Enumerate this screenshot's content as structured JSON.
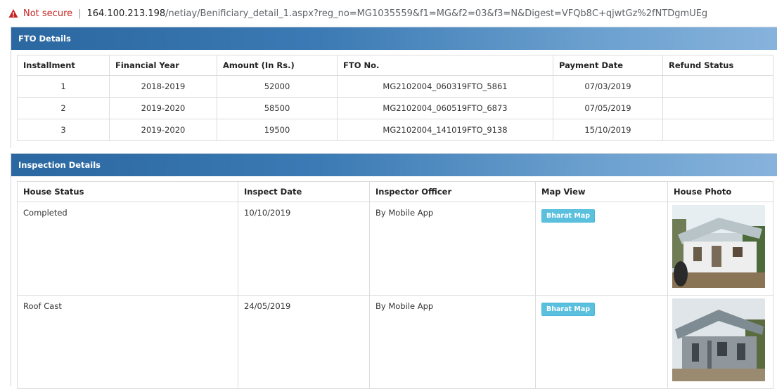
{
  "address_bar": {
    "security_label": "Not secure",
    "separator": "|",
    "url_host": "164.100.213.198",
    "url_path": "/netiay/Benificiary_detail_1.aspx?reg_no=MG1035559&f1=MG&f2=03&f3=N&Digest=VFQb8C+qjwtGz%2fNTDgmUEg"
  },
  "fto": {
    "title": "FTO Details",
    "headers": [
      "Installment",
      "Financial Year",
      "Amount (In Rs.)",
      "FTO No.",
      "Payment Date",
      "Refund Status"
    ],
    "rows": [
      [
        "1",
        "2018-2019",
        "52000",
        "MG2102004_060319FTO_5861",
        "07/03/2019",
        ""
      ],
      [
        "2",
        "2019-2020",
        "58500",
        "MG2102004_060519FTO_6873",
        "07/05/2019",
        ""
      ],
      [
        "3",
        "2019-2020",
        "19500",
        "MG2102004_141019FTO_9138",
        "15/10/2019",
        ""
      ]
    ]
  },
  "inspection": {
    "title": "Inspection Details",
    "headers": [
      "House Status",
      "Inspect Date",
      "Inspector Officer",
      "Map View",
      "House Photo"
    ],
    "rows": [
      {
        "status": "Completed",
        "date": "10/10/2019",
        "officer": "By Mobile App",
        "map_button": "Bharat Map"
      },
      {
        "status": "Roof Cast",
        "date": "24/05/2019",
        "officer": "By Mobile App",
        "map_button": "Bharat Map"
      }
    ]
  },
  "colors": {
    "header_gradient_start": "#2b67a0",
    "header_gradient_end": "#87b3dc",
    "map_button": "#5bc0de",
    "warning_red": "#c5221f"
  }
}
